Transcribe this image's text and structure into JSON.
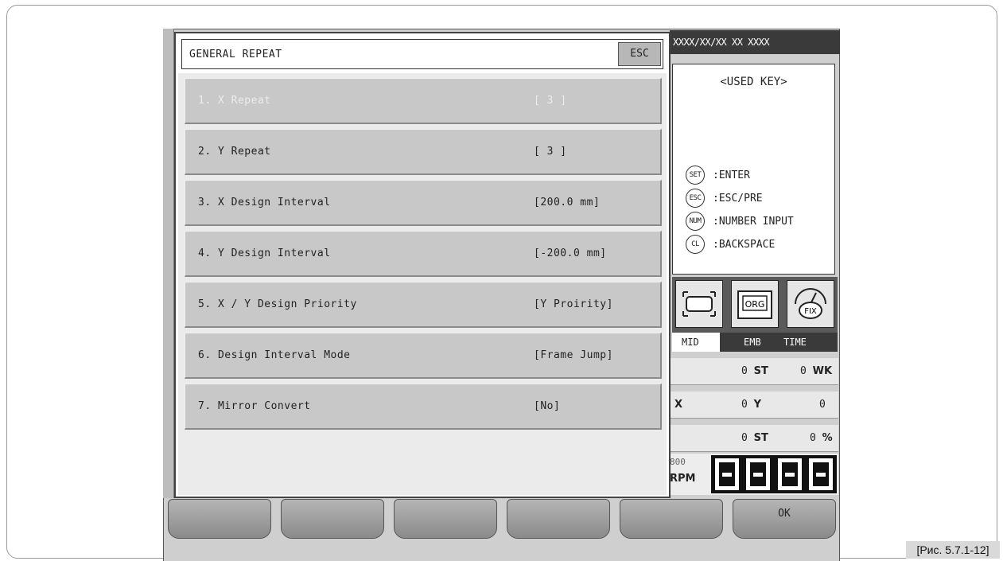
{
  "dialog": {
    "title": "GENERAL REPEAT",
    "esc_label": "ESC",
    "items": [
      {
        "label": "1. X Repeat",
        "value": "[ 3 ]",
        "enabled": false
      },
      {
        "label": "2. Y Repeat",
        "value": "[ 3 ]",
        "enabled": true
      },
      {
        "label": "3. X Design Interval",
        "value": "[200.0 mm]",
        "enabled": true
      },
      {
        "label": "4. Y Design Interval",
        "value": "[-200.0 mm]",
        "enabled": true
      },
      {
        "label": "5. X / Y Design Priority",
        "value": "[Y Proirity]",
        "enabled": true
      },
      {
        "label": "6. Design Interval Mode",
        "value": "[Frame Jump]",
        "enabled": true
      },
      {
        "label": "7. Mirror Convert",
        "value": "[No]",
        "enabled": true
      }
    ]
  },
  "side_panel": {
    "top_bar_text": "XXXX/XX/XX XX XXXX",
    "used_keys_title": "<USED KEY>",
    "keys": [
      {
        "key": "SET",
        "label": ":ENTER"
      },
      {
        "key": "ESC",
        "label": ":ESC/PRE"
      },
      {
        "key": "NUM",
        "label": ":NUMBER INPUT"
      },
      {
        "key": "CL",
        "label": ":BACKSPACE"
      }
    ],
    "mode_icons": {
      "orig": "ORG",
      "fix": "FIX"
    },
    "mode_labels": {
      "mid": "MID",
      "emb": "EMB",
      "time": "TIME"
    },
    "stats": {
      "row1": {
        "st_value": "0",
        "st_unit": "ST",
        "wk_value": "0",
        "wk_unit": "WK"
      },
      "row2": {
        "x_label": "X",
        "x_value": "0",
        "y_label": "Y",
        "y_value": "0"
      },
      "row3": {
        "st_value": "0",
        "st_unit": "ST",
        "pct_value": "0",
        "pct_unit": "%"
      }
    },
    "rpm_value": "800",
    "rpm_unit": "RPM"
  },
  "soft_keys": [
    "",
    "",
    "",
    "",
    "",
    "OK"
  ],
  "figure_caption": "[Рис. 5.7.1-12]"
}
